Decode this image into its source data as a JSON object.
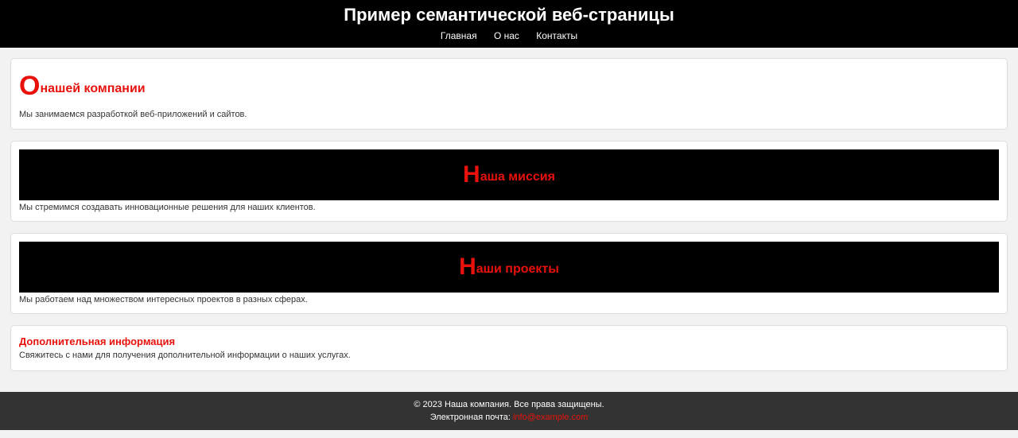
{
  "header": {
    "title": "Пример семантической веб-страницы",
    "nav": [
      "Главная",
      "О нас",
      "Контакты"
    ]
  },
  "sections": {
    "about": {
      "title_first": "О",
      "title_rest": "нашей компании",
      "text": "Мы занимаемся разработкой веб-приложений и сайтов."
    },
    "mission": {
      "title_first": "Н",
      "title_rest": "аша миссия",
      "text": "Мы стремимся создавать инновационные решения для наших клиентов."
    },
    "projects": {
      "title_first": "Н",
      "title_rest": "аши проекты",
      "text": "Мы работаем над множеством интересных проектов в разных сферах."
    },
    "extra": {
      "title": "Дополнительная информация",
      "text": "Свяжитесь с нами для получения дополнительной информации о наших услугах."
    }
  },
  "footer": {
    "copyright": "© 2023 Наша компания. Все права защищены.",
    "email_label": "Электронная почта: ",
    "email": "info@example.com"
  },
  "colors": {
    "accent": "#e8110c",
    "header_bg": "#000000",
    "footer_bg": "#333333",
    "page_bg": "#f2f2f2"
  }
}
